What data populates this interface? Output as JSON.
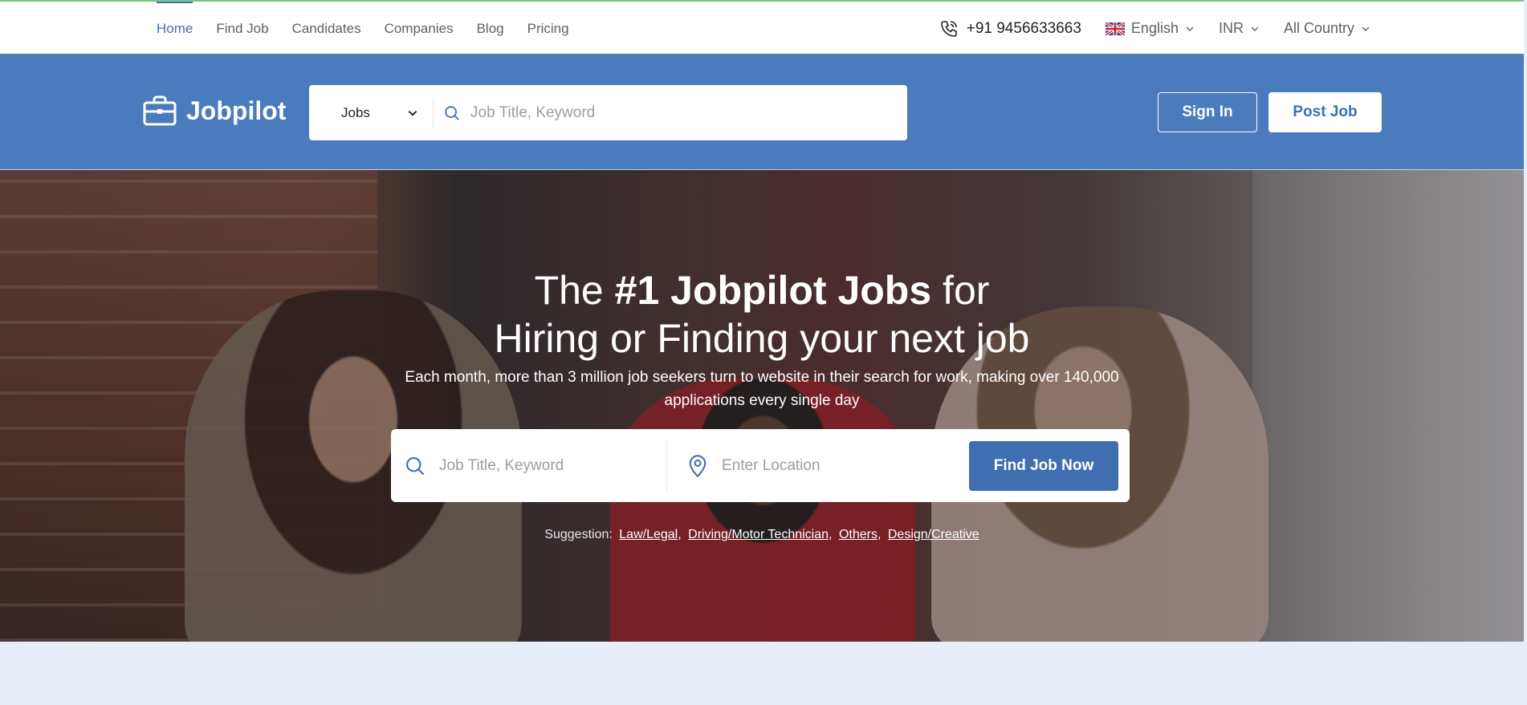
{
  "nav": {
    "items": [
      {
        "label": "Home",
        "active": true
      },
      {
        "label": "Find Job",
        "active": false
      },
      {
        "label": "Candidates",
        "active": false
      },
      {
        "label": "Companies",
        "active": false
      },
      {
        "label": "Blog",
        "active": false
      },
      {
        "label": "Pricing",
        "active": false
      }
    ]
  },
  "topbar": {
    "phone": "+91 9456633663",
    "language": "English",
    "currency": "INR",
    "country": "All Country"
  },
  "header": {
    "logo_text": "Jobpilot",
    "search_type": "Jobs",
    "search_placeholder": "Job Title, Keyword",
    "signin_label": "Sign In",
    "post_job_label": "Post Job"
  },
  "hero": {
    "title_prefix": "The ",
    "title_bold": "#1 Jobpilot Jobs",
    "title_suffix": " for",
    "title_line2": "Hiring or Finding your next job",
    "subtitle": "Each month, more than 3 million job seekers turn to website in their search for work, making over 140,000 applications every single day",
    "keyword_placeholder": "Job Title, Keyword",
    "location_placeholder": "Enter Location",
    "find_button": "Find Job Now",
    "suggestion_label": "Suggestion:",
    "suggestions": [
      "Law/Legal",
      "Driving/Motor Technician",
      "Others",
      "Design/Creative"
    ]
  },
  "colors": {
    "brand": "#4a7bbd",
    "accent": "#3f6fb0",
    "page_bg": "#e8eef8"
  }
}
